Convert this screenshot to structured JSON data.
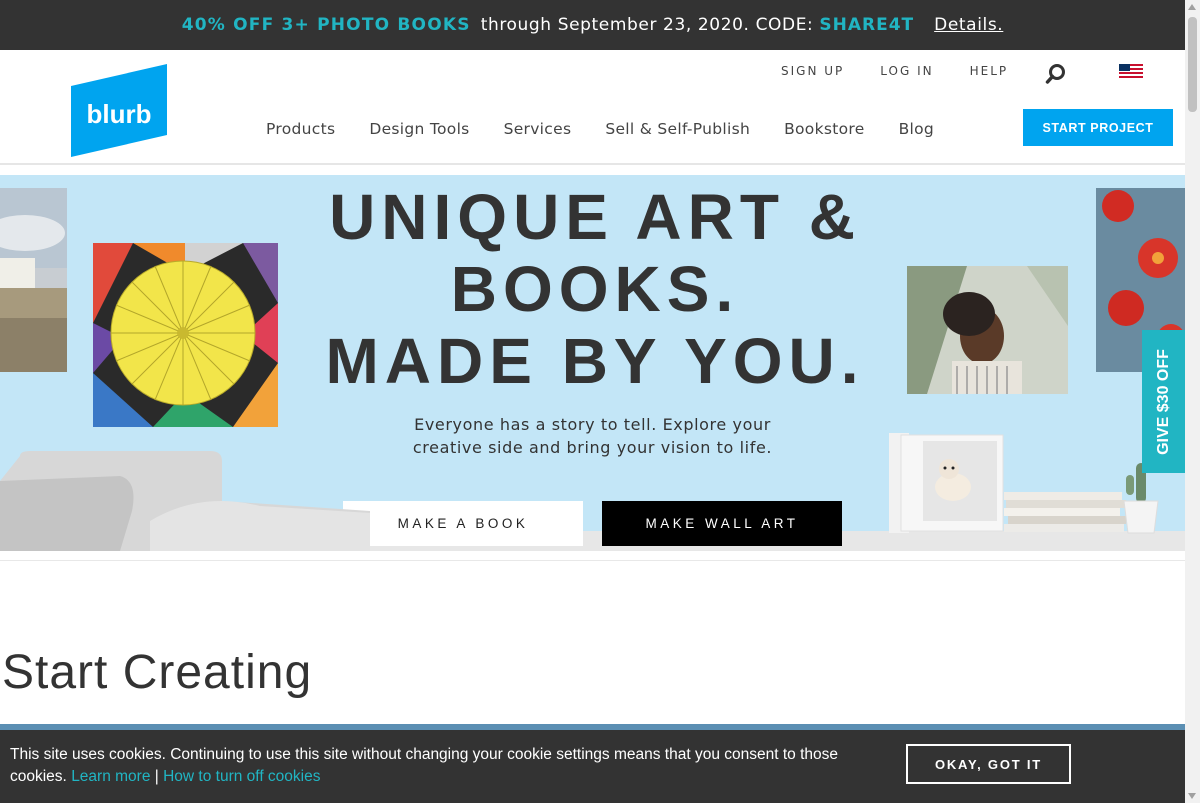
{
  "promo": {
    "highlight": "40% OFF 3+ PHOTO BOOKS",
    "text": "through September 23, 2020. CODE:",
    "code": "SHARE4T",
    "details": "Details."
  },
  "header": {
    "logo_text": "blurb",
    "utility": [
      "SIGN UP",
      "LOG IN",
      "HELP"
    ],
    "nav": [
      "Products",
      "Design Tools",
      "Services",
      "Sell & Self-Publish",
      "Bookstore",
      "Blog"
    ],
    "start_project": "START PROJECT"
  },
  "hero": {
    "title_line1": "UNIQUE ART &",
    "title_line2": "BOOKS.",
    "title_line3": "MADE BY YOU.",
    "subtitle": "Everyone has a story to tell. Explore your creative side and bring your vision to life.",
    "make_book": "MAKE A BOOK",
    "make_wall_art": "MAKE WALL ART"
  },
  "promo_tab": "GIVE $30 OFF",
  "section": {
    "title": "Start Creating"
  },
  "cookie": {
    "message": "This site uses cookies. Continuing to use this site without changing your cookie settings means that you consent to those cookies.",
    "learn_more": "Learn more",
    "separator": "|",
    "turn_off": "How to turn off cookies",
    "ok": "OKAY, GOT IT"
  },
  "icons": {
    "search": "search-icon",
    "flag": "us-flag-icon"
  },
  "colors": {
    "accent": "#21b5c3",
    "brand_blue": "#00a4ef",
    "promo_bg": "#333333",
    "hero_bg": "#c3e6f7"
  }
}
